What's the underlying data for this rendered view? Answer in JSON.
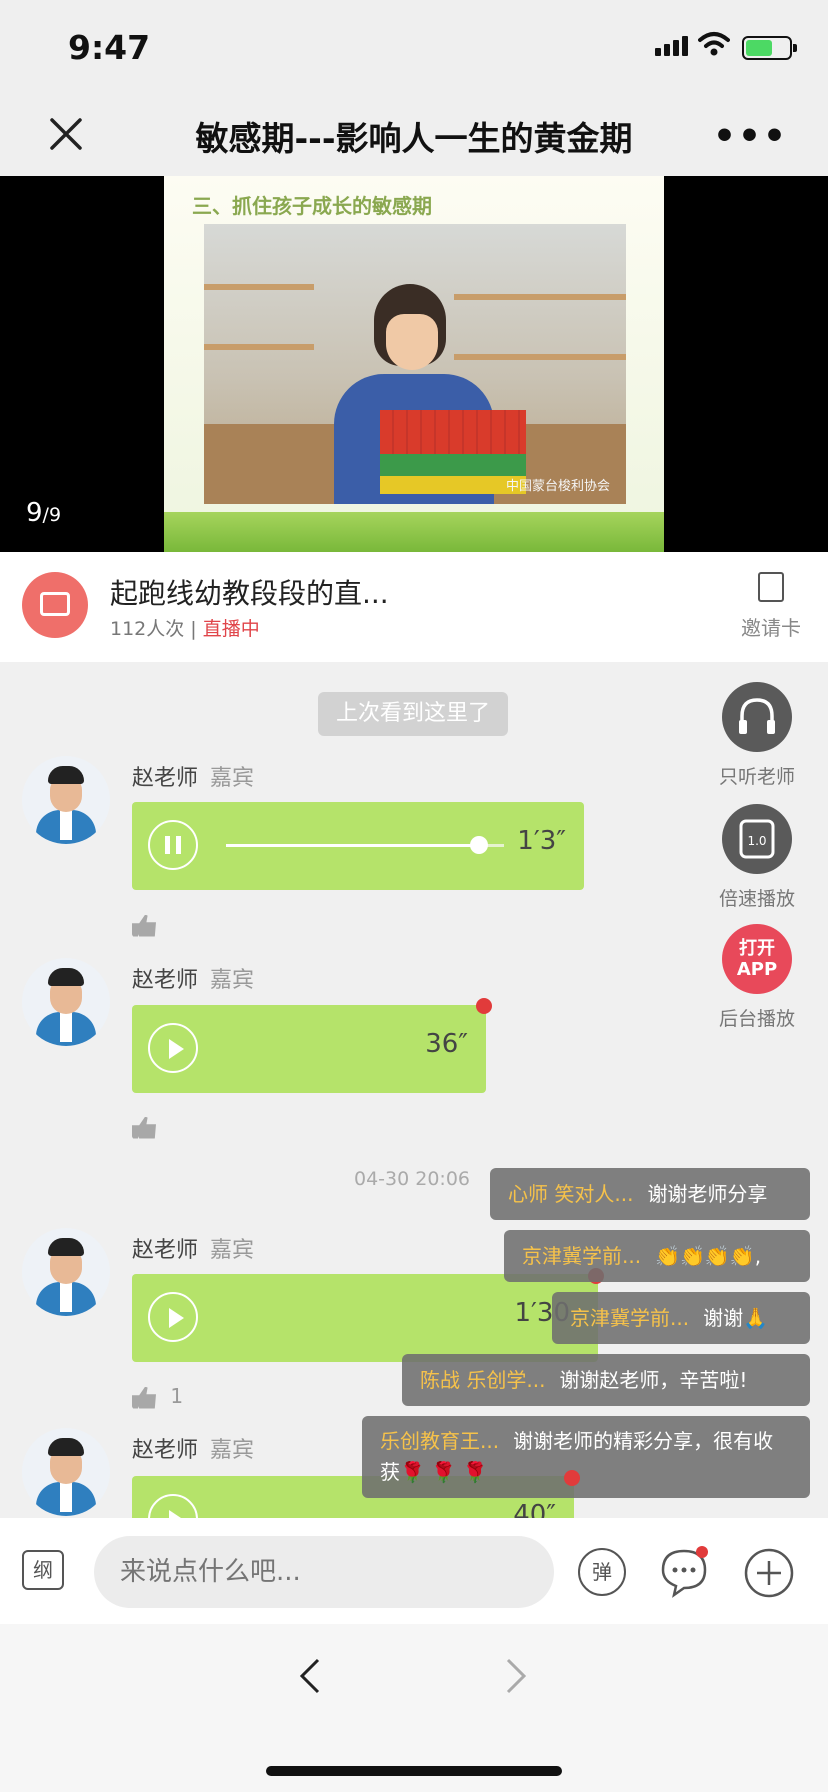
{
  "status": {
    "time": "9:47"
  },
  "nav": {
    "title": "敏感期---影响人一生的黄金期",
    "more": "•••"
  },
  "video": {
    "slide_heading": "三、抓住孩子成长的敏感期",
    "watermark": "中国蒙台梭利协会",
    "page_current": "9",
    "page_total": "/9"
  },
  "channel": {
    "name": "起跑线幼教段段的直...",
    "viewers": "112人次 |",
    "live_status": "直播中",
    "invite_label": "邀请卡"
  },
  "chat": {
    "last_seen": "上次看到这里了",
    "timestamp": "04-30 20:06",
    "messages": [
      {
        "sender": "赵老师",
        "role": "嘉宾",
        "duration": "1′3″",
        "playing": true,
        "progress": 0.85,
        "likes": ""
      },
      {
        "sender": "赵老师",
        "role": "嘉宾",
        "duration": "36″",
        "playing": false,
        "unread": true,
        "likes": ""
      },
      {
        "sender": "赵老师",
        "role": "嘉宾",
        "duration": "1′30",
        "playing": false,
        "unread": true,
        "likes": "1"
      },
      {
        "sender": "赵老师",
        "role": "嘉宾",
        "duration": "40″",
        "playing": false,
        "unread": true,
        "likes": ""
      }
    ]
  },
  "side_buttons": {
    "listen": "只听老师",
    "speed_value": "1.0",
    "speed": "倍速播放",
    "app_line1": "打开",
    "app_line2": "APP",
    "background": "后台播放"
  },
  "danmaku": [
    {
      "who": "心师 笑对人...",
      "text": "谢谢老师分享"
    },
    {
      "who": "京津冀学前...",
      "text": "👏👏👏👏,"
    },
    {
      "who": "京津冀学前...",
      "text": "谢谢🙏"
    },
    {
      "who": "陈战 乐创学...",
      "text": "谢谢赵老师，辛苦啦!"
    },
    {
      "who": "乐创教育王...",
      "text": "谢谢老师的精彩分享，很有收获🌹 🌹 🌹"
    }
  ],
  "input": {
    "calendar": "纲",
    "placeholder": "来说点什么吧...",
    "danmaku_toggle": "弹"
  },
  "colors": {
    "voice_bubble": "#b5e36a",
    "live_red": "#e0454a",
    "danmaku_name": "#f6c24a",
    "app_button": "#e8495a"
  }
}
